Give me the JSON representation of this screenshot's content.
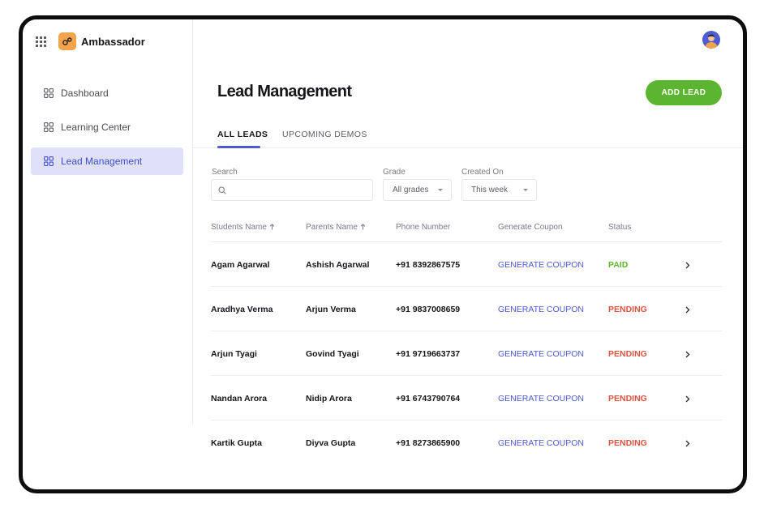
{
  "app": {
    "name": "Ambassador"
  },
  "sidebar": {
    "items": [
      {
        "label": "Dashboard",
        "active": false
      },
      {
        "label": "Learning Center",
        "active": false
      },
      {
        "label": "Lead Management",
        "active": true
      }
    ]
  },
  "page": {
    "title": "Lead Management",
    "add_button": "ADD LEAD"
  },
  "tabs": [
    {
      "label": "ALL LEADS",
      "active": true
    },
    {
      "label": "UPCOMING DEMOS",
      "active": false
    }
  ],
  "filters": {
    "search": {
      "label": "Search",
      "value": "",
      "placeholder": ""
    },
    "grade": {
      "label": "Grade",
      "value": "All grades"
    },
    "created_on": {
      "label": "Created On",
      "value": "This week"
    }
  },
  "table": {
    "headers": [
      "Students Name",
      "Parents Name",
      "Phone Number",
      "Generate Coupon",
      "Status"
    ],
    "rows": [
      {
        "student": "Agam Agarwal",
        "parent": "Ashish Agarwal",
        "phone": "+91 8392867575",
        "coupon": "GENERATE COUPON",
        "status": "PAID"
      },
      {
        "student": "Aradhya Verma",
        "parent": "Arjun Verma",
        "phone": "+91 9837008659",
        "coupon": "GENERATE COUPON",
        "status": "PENDING"
      },
      {
        "student": "Arjun Tyagi",
        "parent": "Govind Tyagi",
        "phone": "+91 9719663737",
        "coupon": "GENERATE COUPON",
        "status": "PENDING"
      },
      {
        "student": "Nandan Arora",
        "parent": "Nidip Arora",
        "phone": "+91 6743790764",
        "coupon": "GENERATE COUPON",
        "status": "PENDING"
      },
      {
        "student": "Kartik Gupta",
        "parent": "Diyva Gupta",
        "phone": "+91 8273865900",
        "coupon": "GENERATE COUPON",
        "status": "PENDING"
      }
    ]
  },
  "colors": {
    "accent": "#4d5bd4",
    "primary_button": "#5cb530",
    "status_paid": "#5cb530",
    "status_pending": "#e0533f",
    "nav_active_bg": "#dfe1f9",
    "logo_bg": "#f3a34a"
  },
  "icons": {
    "apps": "apps-grid-icon",
    "logo": "ambassador-logo-icon",
    "nav": "grid-four-icon",
    "search": "search-icon",
    "sort": "arrow-up-icon",
    "dropdown": "caret-down-icon",
    "row_action": "chevron-right-icon",
    "user": "avatar"
  }
}
